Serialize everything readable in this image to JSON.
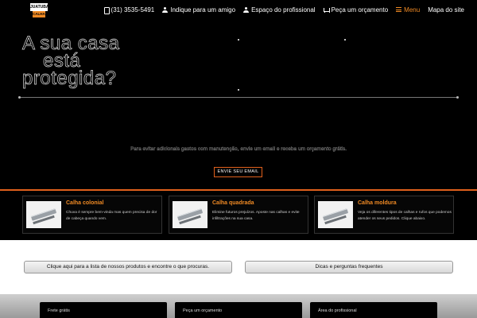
{
  "logo": {
    "line1": "JUATUBA",
    "line2": "CALHAS"
  },
  "nav": {
    "phone": "(31) 3535-5491",
    "refer": "Indique para um amigo",
    "professional": "Espaço do profissional",
    "quote": "Peça um orçamento",
    "menu": "Menu",
    "sitemap": "Mapa do site"
  },
  "hero": {
    "headline": [
      "A sua casa",
      "está",
      "protegida?"
    ],
    "text": "Para evitar adicionais gastos com manutenção, envie um email e receba um orçamento grátis.",
    "button": "ENVIE SEU EMAIL"
  },
  "products": [
    {
      "title": "Calha colonial",
      "desc": "Chuva é sempre bem-vinda mas quem precisa de dor de cabeça quando vem."
    },
    {
      "title": "Calha quadrada",
      "desc": "Elimine futuros prejuízos. Aposte nas calhas e evite infiltrações na sua casa."
    },
    {
      "title": "Calha moldura",
      "desc": "Veja os diferentes tipos de calhas e rufos que podemos atender os seus pedidos. Clique abaixo."
    }
  ],
  "links": {
    "products": "Clique aqui para a lista de nossos produtos e encontre o que procuras.",
    "faq": "Dicas e perguntas frequentes"
  },
  "tiles": [
    "Frete grátis",
    "Peça um orçamento",
    "Área do profissional"
  ],
  "colors": {
    "accent": "#f08a24",
    "accent_dark": "#e0601c"
  }
}
